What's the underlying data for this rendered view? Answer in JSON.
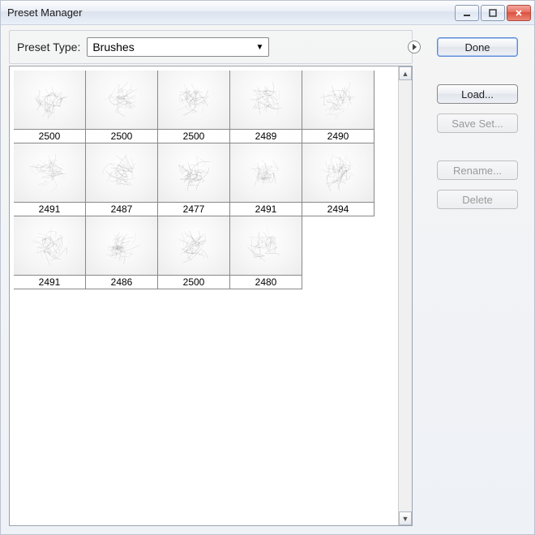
{
  "window": {
    "title": "Preset Manager"
  },
  "sysbuttons": {
    "min": "minimize",
    "max": "maximize",
    "close": "close"
  },
  "preset": {
    "label": "Preset Type:",
    "value": "Brushes"
  },
  "buttons": {
    "done": "Done",
    "load": "Load...",
    "save_set": "Save Set...",
    "rename": "Rename...",
    "delete": "Delete"
  },
  "brushes": [
    {
      "id": "2500"
    },
    {
      "id": "2500"
    },
    {
      "id": "2500"
    },
    {
      "id": "2489"
    },
    {
      "id": "2490"
    },
    {
      "id": "2491"
    },
    {
      "id": "2487"
    },
    {
      "id": "2477"
    },
    {
      "id": "2491"
    },
    {
      "id": "2494"
    },
    {
      "id": "2491"
    },
    {
      "id": "2486"
    },
    {
      "id": "2500"
    },
    {
      "id": "2480"
    }
  ]
}
